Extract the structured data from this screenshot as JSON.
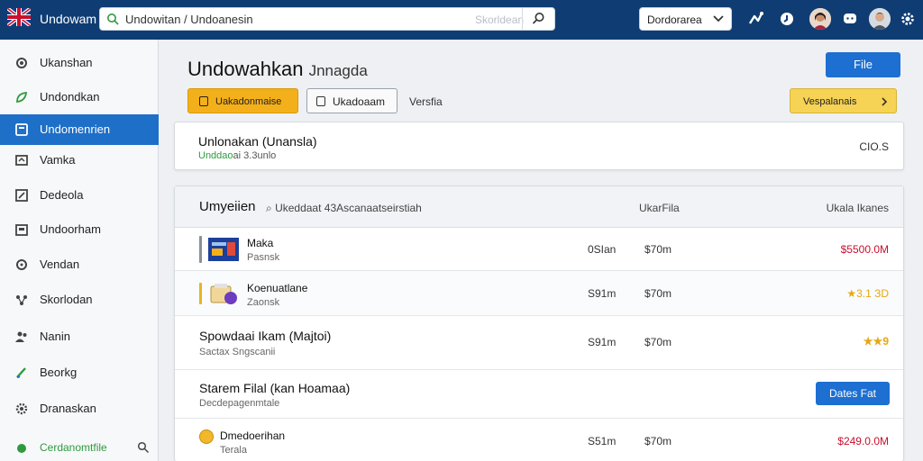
{
  "header": {
    "app_title": "Undowam",
    "search_value": "Undowitan / Undoanesin",
    "search_placeholder": "Skorldean",
    "language": "Dordorarea"
  },
  "sidebar": {
    "items": [
      {
        "label": "Ukanshan"
      },
      {
        "label": "Undondkan"
      },
      {
        "label": "Undomenrien"
      },
      {
        "label": "Vamka"
      },
      {
        "label": "Dedeola"
      },
      {
        "label": "Undoorham"
      },
      {
        "label": "Vendan"
      },
      {
        "label": "Skorlodan"
      },
      {
        "label": "Nanin"
      },
      {
        "label": "Beorkg"
      },
      {
        "label": "Dranaskan"
      }
    ],
    "footer_label": "Cerdanomtfile"
  },
  "main": {
    "title": "Undowahkan",
    "title_sub": "Jnnagda",
    "file_button": "File",
    "primary_button": "Uakadonmaise",
    "secondary_button": "Ukadoaam",
    "version_link": "Versfia",
    "right_button": "Vespalanais",
    "summary": {
      "title": "Unlonakan (Unansla)",
      "sub_green": "Unddao",
      "sub_rest": "ai 3.3unlo",
      "right": "CIO.S"
    },
    "table": {
      "title": "Umyeiien",
      "search": "Ukeddaat 43Ascanaatseirstiah",
      "col1": "UkarFila",
      "col2": "Ukala Ikanes",
      "rows": [
        {
          "title": "Maka",
          "sub": "Pasnsk",
          "c1": "0SIan",
          "c2": "$70m",
          "value": "$5500.0M"
        },
        {
          "title": "Koenuatlane",
          "sub": "Zaonsk",
          "c1": "S91m",
          "c2": "$70m",
          "value": "★3.1 ЗD"
        },
        {
          "title": "Spowdaai Ikam (Majtoi)",
          "sub": "Sactax Sngscanii",
          "c1": "S91m",
          "c2": "$70m",
          "value": "★★9"
        },
        {
          "title": "Starem Filal (kan Hoamaa)",
          "sub": "Decdepagenmtale",
          "button": "Dates Fat"
        },
        {
          "title": "Dmedoerihan",
          "sub": "Terala",
          "c1": "S51m",
          "c2": "$70m",
          "value": "$249.0.0M"
        }
      ]
    }
  },
  "colors": {
    "topbar": "#0f3d73",
    "accent_blue": "#1d6fd1",
    "sidebar_active": "#1e6fc8",
    "yellow": "#f4b01a",
    "value_red": "#c8102e",
    "star_gold": "#e6a812",
    "green": "#2e9a3d"
  }
}
